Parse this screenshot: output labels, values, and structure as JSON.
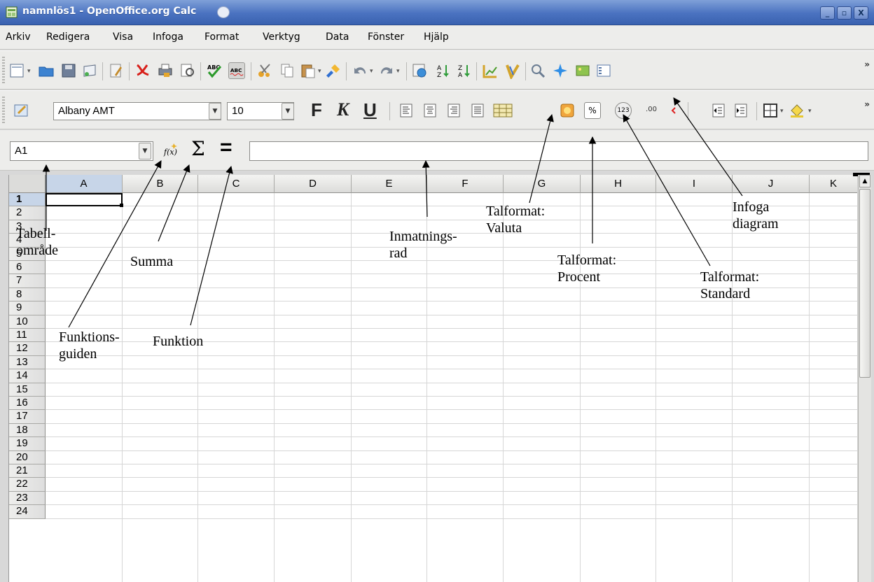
{
  "window": {
    "title": "namnlös1 - OpenOffice.org Calc",
    "controls": [
      "_",
      "▫",
      "X"
    ]
  },
  "menu": [
    "Arkiv",
    "Redigera",
    "Visa",
    "Infoga",
    "Format",
    "Verktyg",
    "Data",
    "Fönster",
    "Hjälp"
  ],
  "format_toolbar": {
    "font_name": "Albany AMT",
    "font_size": "10",
    "bold_label": "F",
    "italic_label": "K",
    "underline_label": "U",
    "percent_label": "%",
    "standard_label": "123",
    "decimal_label": ".00"
  },
  "formula_bar": {
    "name_box": "A1",
    "sum_symbol": "Σ",
    "equals_symbol": "=",
    "input_value": ""
  },
  "grid": {
    "columns": [
      "A",
      "B",
      "C",
      "D",
      "E",
      "F",
      "G",
      "H",
      "I",
      "J",
      "K"
    ],
    "rows": [
      "1",
      "2",
      "3",
      "4",
      "5",
      "6",
      "7",
      "8",
      "9",
      "10",
      "11",
      "12",
      "13",
      "14",
      "15",
      "16",
      "17",
      "18",
      "19",
      "20",
      "21",
      "22",
      "23",
      "24"
    ],
    "selected_cell": "A1"
  },
  "annotations": {
    "tabellomrade": [
      "Tabell-",
      "område"
    ],
    "summa": "Summa",
    "funktionsguiden": [
      "Funktions-",
      "guiden"
    ],
    "funktion": "Funktion",
    "inmatningsrad": [
      "Inmatnings-",
      "rad"
    ],
    "talformat_valuta": [
      "Talformat:",
      "Valuta"
    ],
    "talformat_procent": [
      "Talformat:",
      "Procent"
    ],
    "talformat_standard": [
      "Talformat:",
      "Standard"
    ],
    "infoga_diagram": [
      "Infoga",
      "diagram"
    ]
  }
}
